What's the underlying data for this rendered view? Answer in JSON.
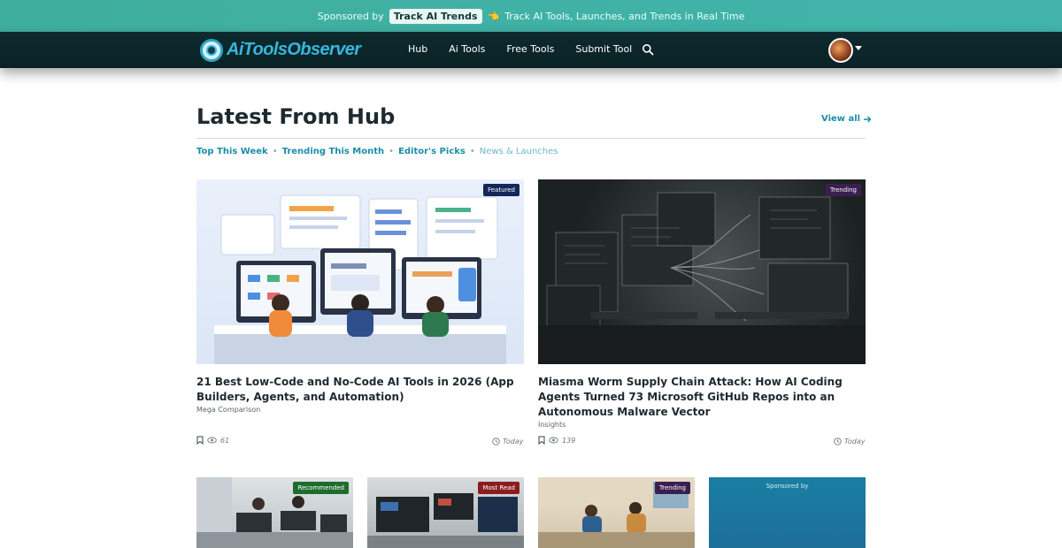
{
  "sponsor_bar": {
    "prefix": "Sponsored by",
    "pill": "Track AI Trends",
    "emoji": "👈",
    "tagline": "Track AI Tools, Launches, and Trends in Real Time"
  },
  "navbar": {
    "logo_text": "AiToolsObserver",
    "links": [
      "Hub",
      "Ai Tools",
      "Free Tools",
      "Submit Tool"
    ],
    "search_icon": "search-icon",
    "avatar_icon": "avatar",
    "caret_icon": "caret-down-icon"
  },
  "section": {
    "title": "Latest From Hub",
    "view_all": "View all",
    "view_all_icon": "arrow-right-icon",
    "filters": [
      "Top This Week",
      "Trending This Month",
      "Editor's Picks",
      "News & Launches"
    ]
  },
  "cards": [
    {
      "badge": "Featured",
      "title": "21 Best Low-Code and No-Code AI Tools in 2026 (App Builders, Agents, and Automation)",
      "category": "Mega Comparison",
      "views": "61",
      "time": "Today"
    },
    {
      "badge": "Trending",
      "title": "Miasma Worm Supply Chain Attack: How AI Coding Agents Turned 73 Microsoft GitHub Repos into an Autonomous Malware Vector",
      "category": "Insights",
      "views": "139",
      "time": "Today"
    }
  ],
  "small_cards": [
    {
      "badge": "Recommended"
    },
    {
      "badge": "Most Read"
    },
    {
      "badge": "Trending"
    }
  ],
  "sponsored_box": {
    "label": "Sponsored by"
  },
  "colors": {
    "accent": "#1b8ea8",
    "navbar": "#0d2a2e",
    "sponsor_bar": "#42b4ab"
  }
}
